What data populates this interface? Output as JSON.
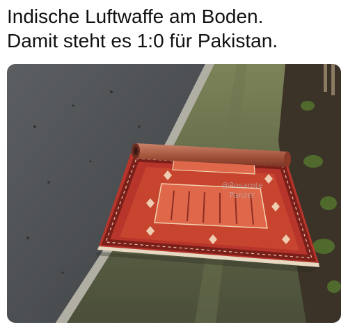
{
  "caption": {
    "line1": "Indische Luftwaffe am Boden.",
    "line2": "Damit steht es 1:0 für Pakistan."
  },
  "photo": {
    "watermark_line1": "@Rosarote",
    "watermark_line2": "Panzer"
  },
  "colors": {
    "text": "#111111",
    "rug_red": "#c0392b",
    "rug_dark": "#7a1f1a",
    "asphalt": "#4a4d50",
    "curb": "#a9a79c",
    "moss": "#6f7a4d"
  }
}
